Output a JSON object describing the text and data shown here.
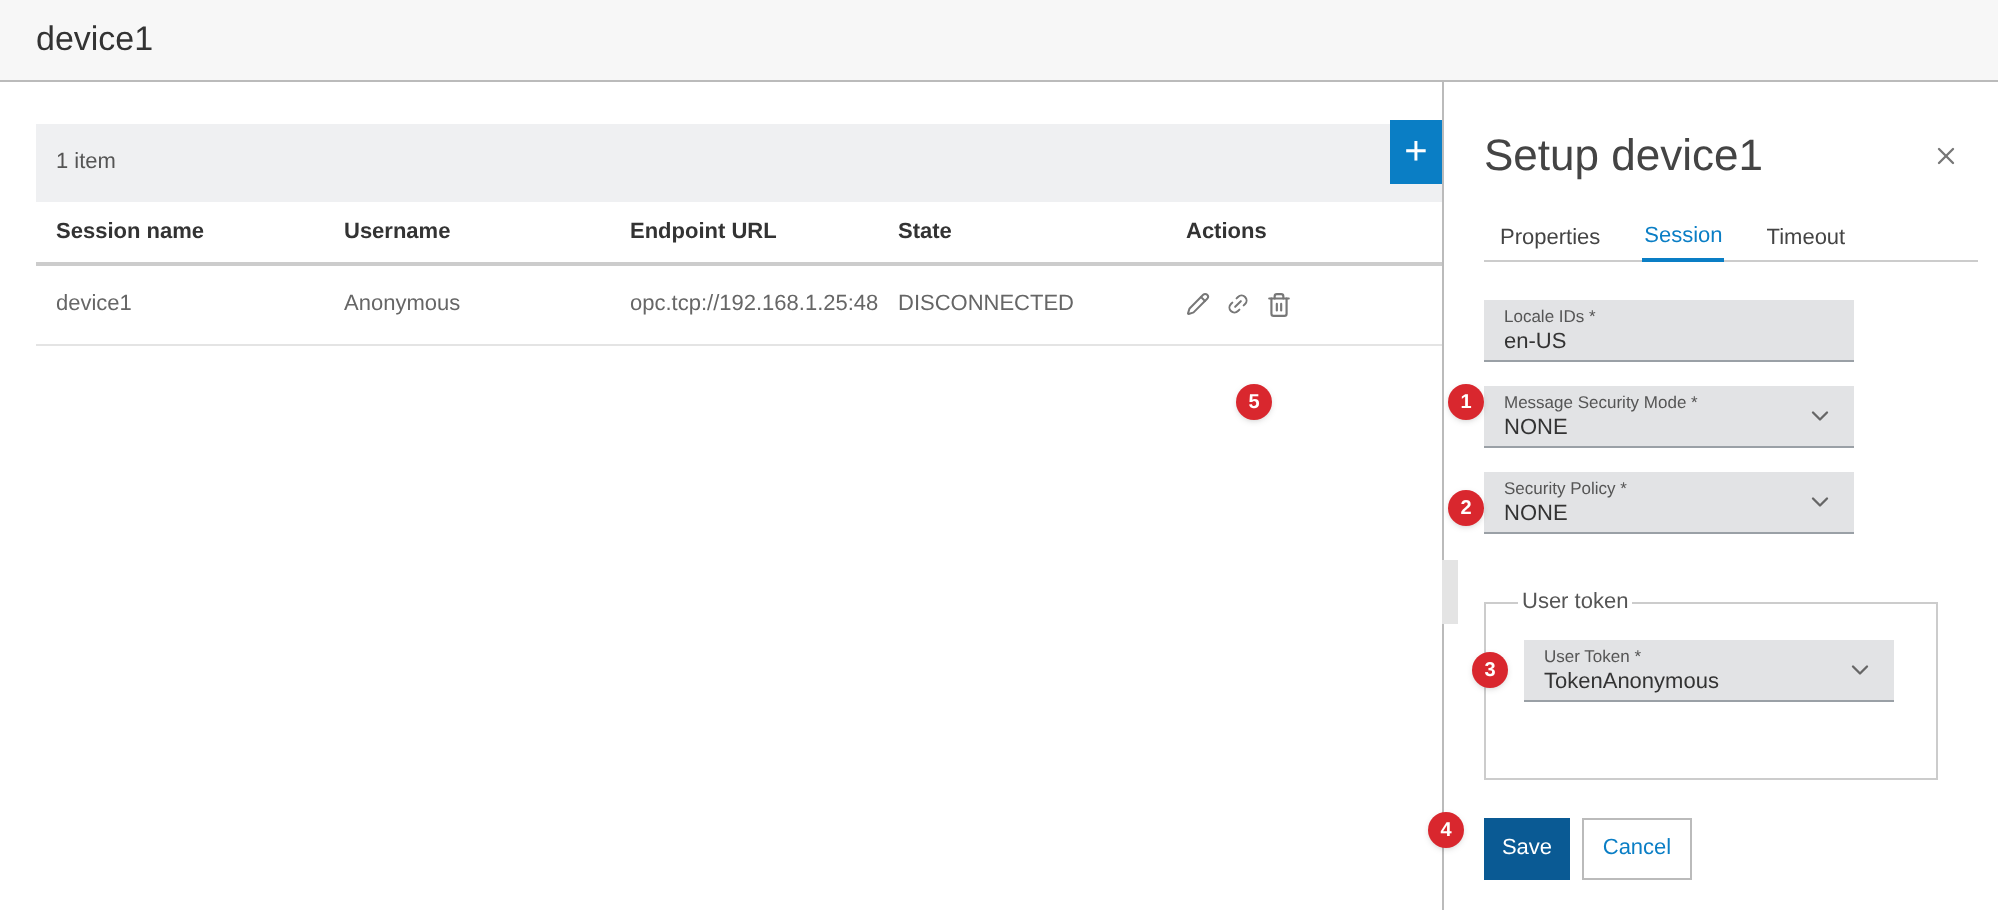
{
  "header": {
    "title": "device1"
  },
  "toolbar": {
    "count": "1 item",
    "add_button": "+"
  },
  "table": {
    "columns": [
      "Session name",
      "Username",
      "Endpoint URL",
      "State",
      "Actions"
    ],
    "rows": [
      {
        "cells": [
          "device1",
          "Anonymous",
          "opc.tcp://192.168.1.25:48",
          "DISCONNECTED"
        ]
      }
    ]
  },
  "panel": {
    "title": "Setup device1",
    "tabs": [
      {
        "label": "Properties",
        "selected": false
      },
      {
        "label": "Session",
        "selected": true
      },
      {
        "label": "Timeout",
        "selected": false
      }
    ],
    "fields": [
      {
        "kind": "text",
        "label": "Locale IDs *",
        "value": "en-US"
      },
      {
        "kind": "select",
        "label": "Message Security Mode *",
        "value": "NONE"
      },
      {
        "kind": "select",
        "label": "Security Policy *",
        "value": "NONE"
      }
    ],
    "group": {
      "legend": "User token",
      "field": {
        "kind": "select",
        "label": "User Token *",
        "value": "TokenAnonymous"
      }
    },
    "buttons": [
      {
        "label": "Save",
        "kind": "primary"
      },
      {
        "label": "Cancel",
        "kind": "secondary"
      }
    ]
  },
  "callouts": [
    "1",
    "2",
    "3",
    "4",
    "5"
  ]
}
